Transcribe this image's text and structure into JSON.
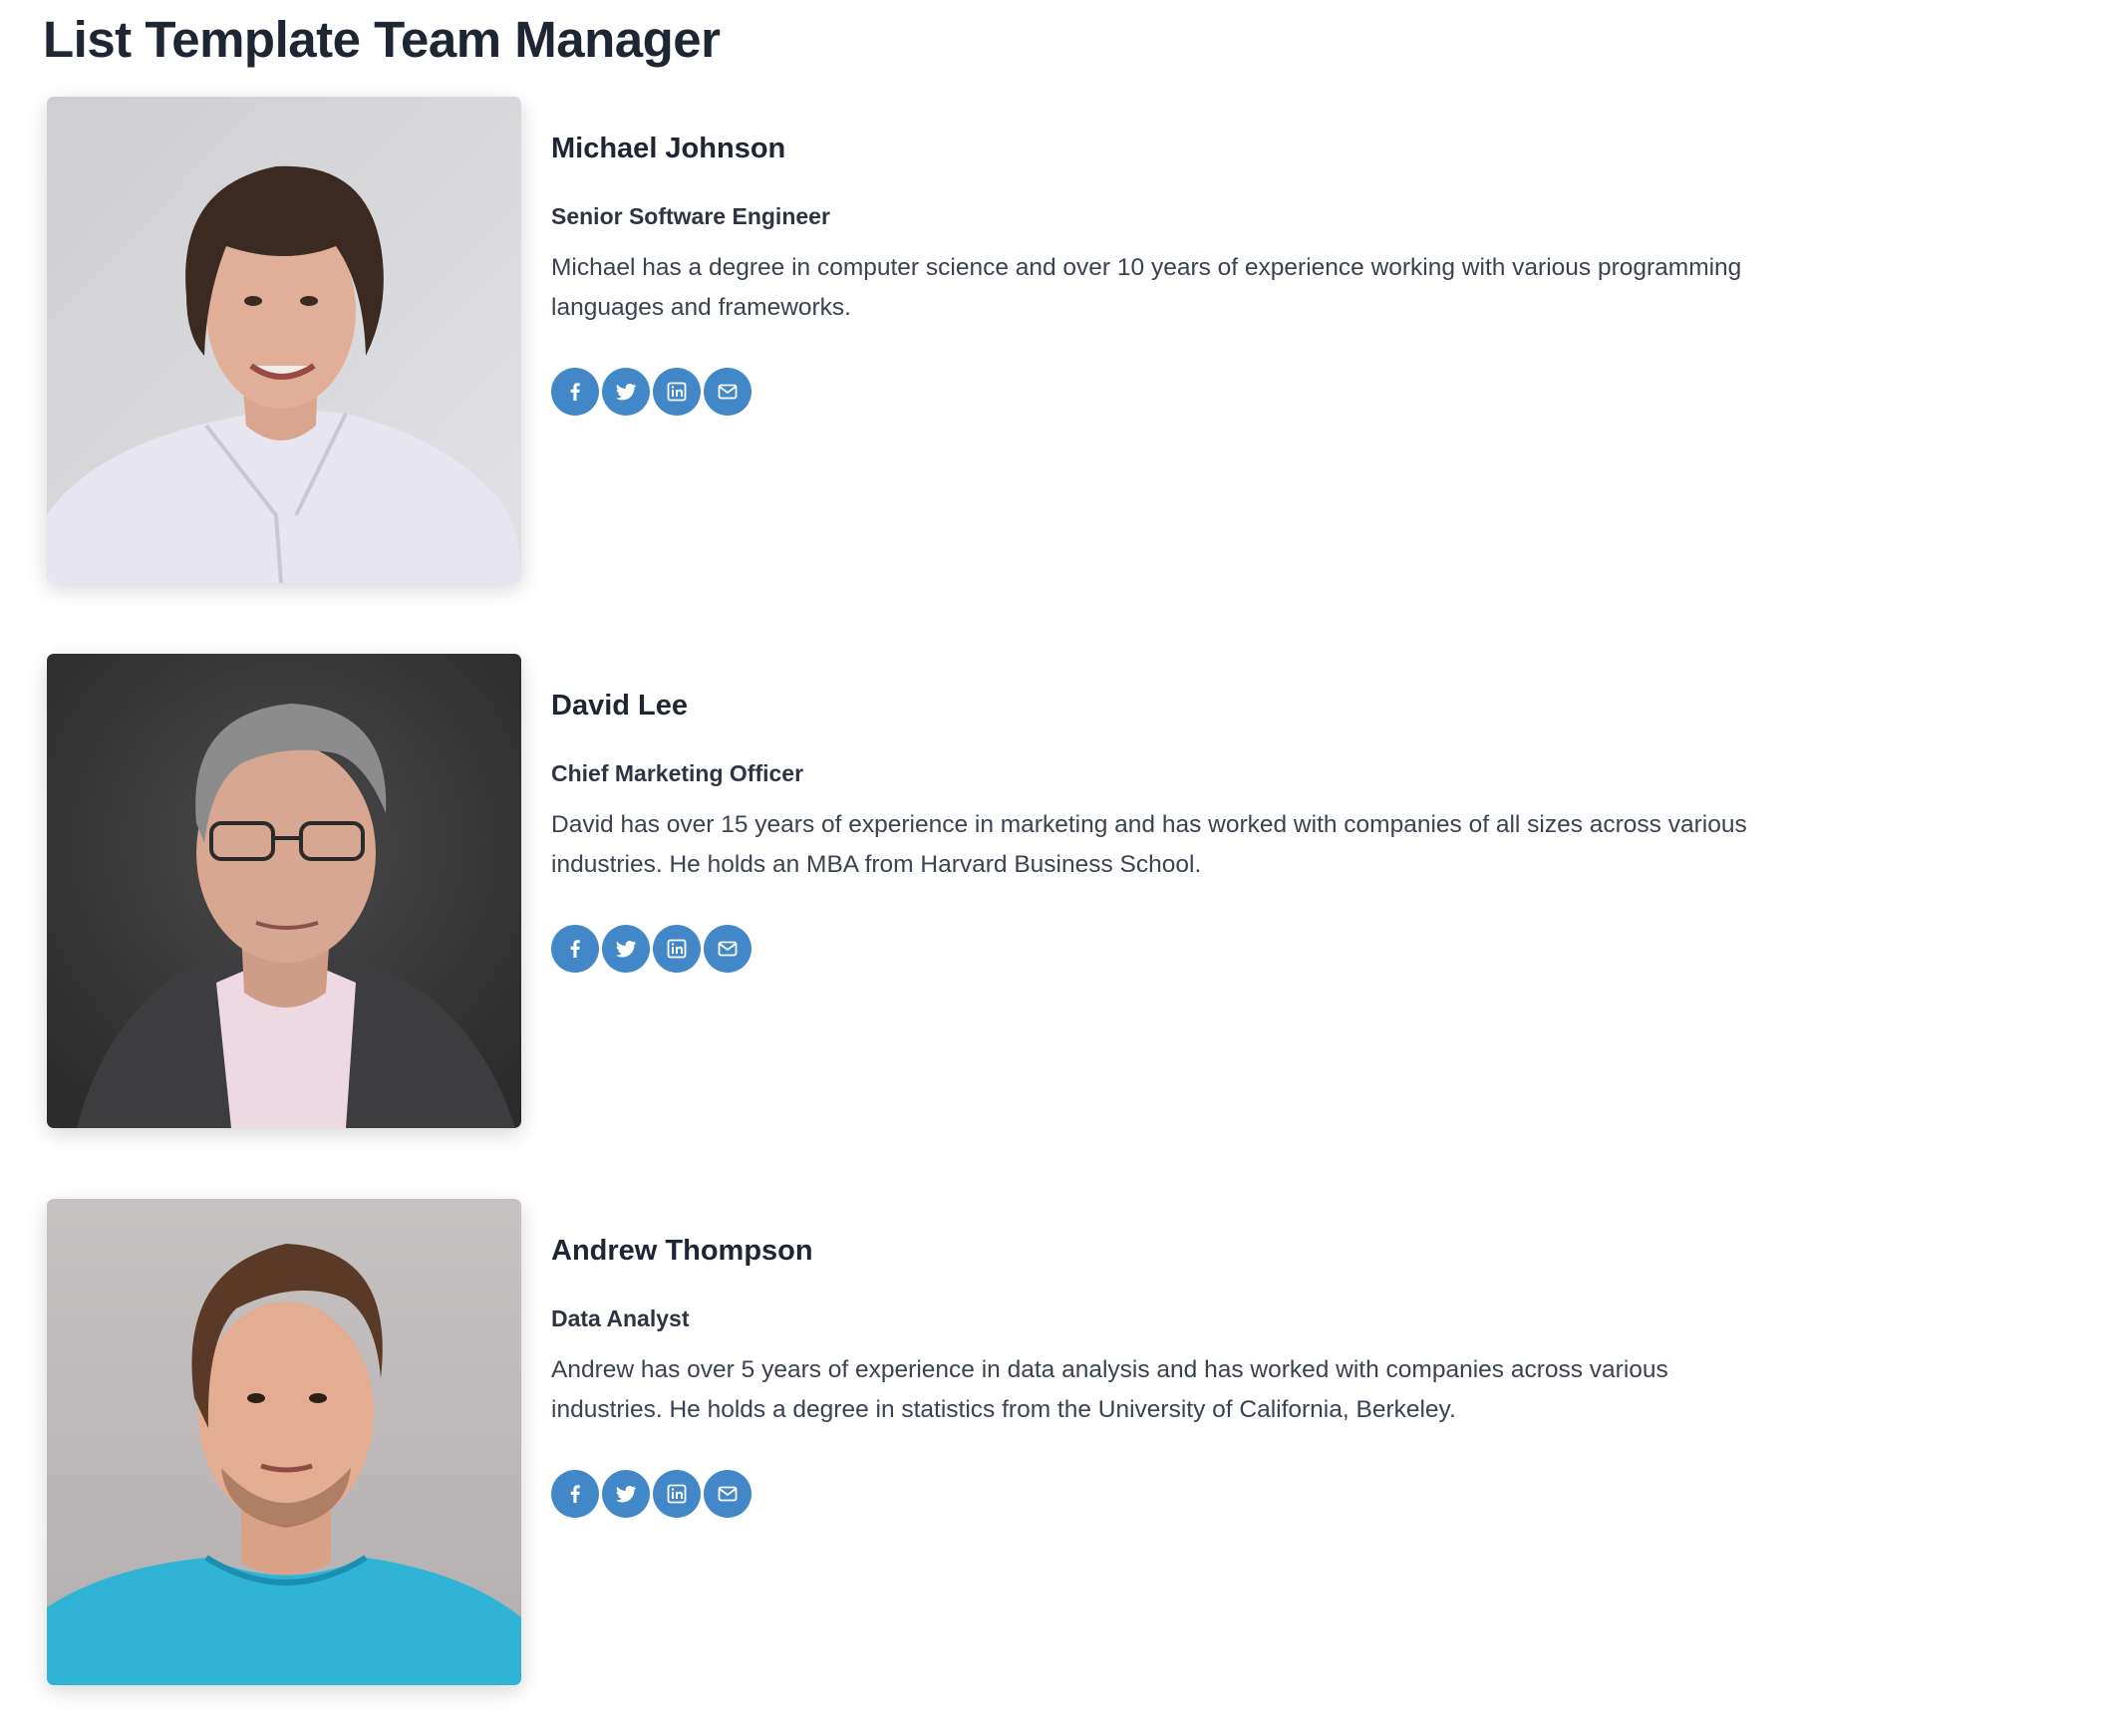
{
  "page": {
    "title": "List Template Team Manager"
  },
  "theme": {
    "accent": "#4287c7",
    "text": "#1e2634"
  },
  "members": [
    {
      "name": "Michael Johnson",
      "role": "Senior Software Engineer",
      "bio": "Michael has a degree in computer science and over 10 years of experience working with various programming languages and frameworks.",
      "socials": [
        "facebook-icon",
        "twitter-icon",
        "linkedin-icon",
        "email-icon"
      ]
    },
    {
      "name": "David Lee",
      "role": "Chief Marketing Officer",
      "bio": "David has over 15 years of experience in marketing and has worked with companies of all sizes across various industries. He holds an MBA from Harvard Business School.",
      "socials": [
        "facebook-icon",
        "twitter-icon",
        "linkedin-icon",
        "email-icon"
      ]
    },
    {
      "name": "Andrew Thompson",
      "role": "Data Analyst",
      "bio": "Andrew has over 5 years of experience in data analysis and has worked with companies across various industries. He holds a degree in statistics from the University of California, Berkeley.",
      "socials": [
        "facebook-icon",
        "twitter-icon",
        "linkedin-icon",
        "email-icon"
      ]
    }
  ]
}
